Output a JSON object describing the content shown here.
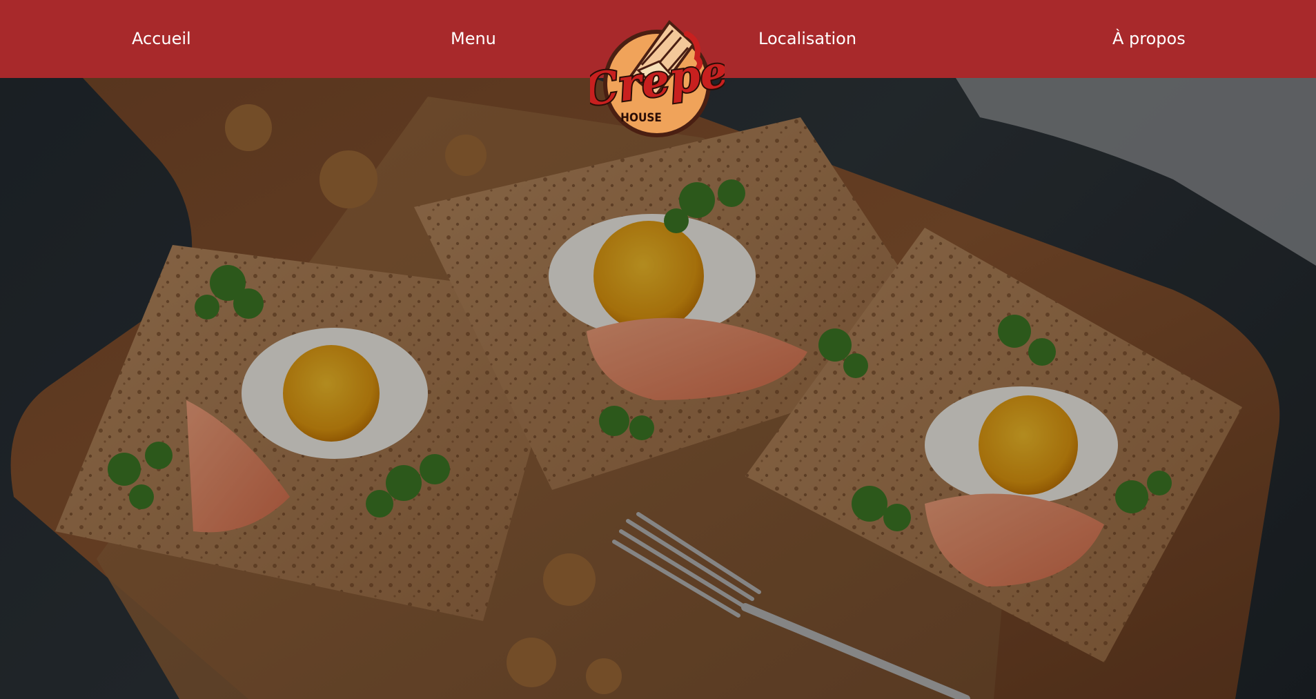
{
  "nav": {
    "items": [
      {
        "label": "Accueil"
      },
      {
        "label": "Menu"
      },
      {
        "label": "Localisation"
      },
      {
        "label": "À propos"
      }
    ]
  },
  "logo": {
    "name": "Crepe",
    "tagline": "HOUSE",
    "icon": "crepe-roll-icon"
  },
  "hero": {
    "image": "galette-crepes-with-egg-salmon-parsley-on-wooden-board"
  },
  "colors": {
    "nav_background": "#a8292b",
    "nav_text": "#ffffff",
    "logo_red": "#c8201f",
    "logo_orange": "#f0a35a"
  }
}
